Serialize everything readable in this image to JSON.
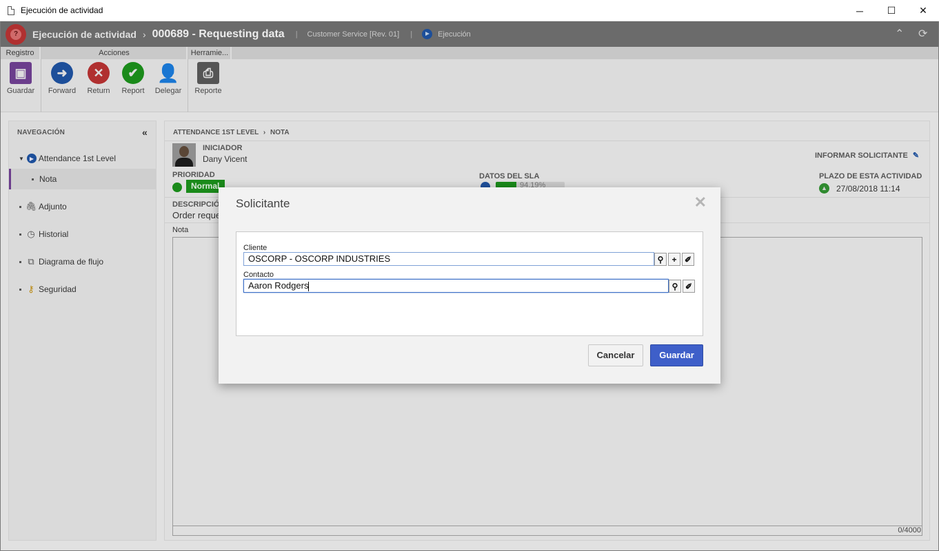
{
  "window": {
    "title": "Ejecución de actividad",
    "minimize": "─",
    "maximize": "☐",
    "close": "✕"
  },
  "header": {
    "crumb1": "Ejecución de actividad",
    "sep": "›",
    "crumb2": "000689 - Requesting data",
    "pipe": "|",
    "service": "Customer Service [Rev. 01]",
    "status": "Ejecución",
    "collapse_glyph": "⌃",
    "refresh_glyph": "⟳"
  },
  "ribbon": {
    "groups": {
      "registro": "Registro",
      "acciones": "Acciones",
      "herramientas": "Herramie..."
    },
    "tools": {
      "guardar": "Guardar",
      "forward": "Forward",
      "return": "Return",
      "report": "Report",
      "delegar": "Delegar",
      "reporte": "Reporte"
    },
    "colors": {
      "guardar": "#6b3d8c",
      "forward": "#1d4f9a",
      "return": "#b03030",
      "report": "#1a8a1a",
      "delegar": "#1d4f9a",
      "reporte": "#555555"
    }
  },
  "nav": {
    "heading": "NAVEGACIÓN",
    "collapse_glyph": "«",
    "items": {
      "attendance": "Attendance 1st Level",
      "nota": "Nota",
      "adjunto": "Adjunto",
      "historial": "Historial",
      "diagrama": "Diagrama de flujo",
      "seguridad": "Seguridad"
    }
  },
  "main": {
    "breadcrumb": "ATTENDANCE 1ST LEVEL",
    "breadcrumb_sep": "›",
    "breadcrumb2": "NOTA",
    "initiator_label": "INICIADOR",
    "initiator_name": "Dany Vicent",
    "inform_requester": "INFORMAR SOLICITANTE",
    "priority_label": "PRIORIDAD",
    "priority_value": "Normal",
    "sla_label": "DATOS DEL SLA",
    "sla_value": "94.19%",
    "sla_fraction": 0.3,
    "deadline_label": "PLAZO DE ESTA ACTIVIDAD",
    "deadline_value": "27/08/2018 11:14",
    "description_label": "DESCRIPCIÓN",
    "description_value": "Order request",
    "note_label": "Nota",
    "counter": "0/4000"
  },
  "modal": {
    "title": "Solicitante",
    "close_glyph": "✕",
    "client_label": "Cliente",
    "client_value": "OSCORP - OSCORP INDUSTRIES",
    "contact_label": "Contacto",
    "contact_value": "Aaron Rodgers",
    "cancel": "Cancelar",
    "save": "Guardar"
  }
}
